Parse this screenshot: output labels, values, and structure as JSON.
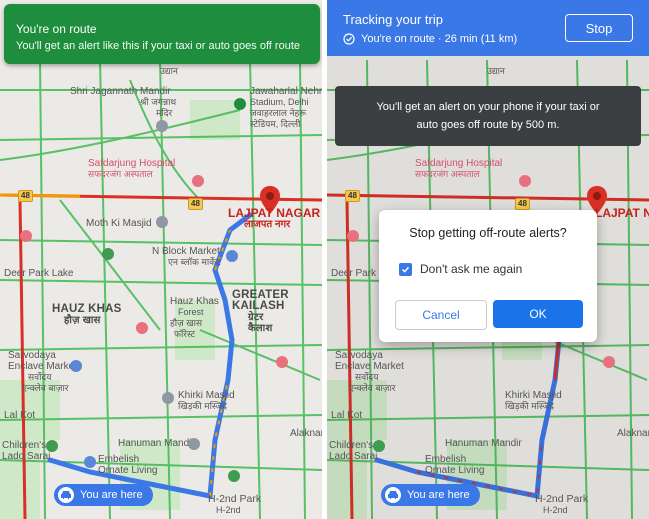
{
  "left": {
    "banner": {
      "title": "You're on route",
      "subtitle": "You'll get an alert like this if your taxi or auto goes off route"
    }
  },
  "right": {
    "header": {
      "title": "Tracking your trip",
      "status": "You're on route · 26 min (11 km)",
      "stop_label": "Stop"
    },
    "toast": {
      "line1": "You'll get an alert on your phone if your taxi or",
      "line2": "auto goes off route by 500 m."
    },
    "dialog": {
      "question": "Stop getting off-route alerts?",
      "checkbox_label": "Don't ask me again",
      "checkbox_checked": true,
      "cancel_label": "Cancel",
      "ok_label": "OK"
    }
  },
  "map": {
    "labels": {
      "shri_jagannath": "Shri Jagannath Mandir",
      "shri_jagannath_hi": "श्री जगन्नाथ",
      "shri_jagannath_hi2": "मंदिर",
      "jawaharlal": "Jawaharlal Nehru",
      "stadium": "Stadium, Delhi",
      "stadium_hi": "जवाहरलाल नेहरू",
      "stadium_hi2": "स्टेडियम, दिल्ली",
      "safdarjung": "Safdarjung Hospital",
      "safdarjung_hi": "सफदरजंग अस्पताल",
      "moth_ki_masjid": "Moth Ki Masjid",
      "lajpat_nagar": "LAJPAT NAGAR",
      "lajpat_nagar_hi": "लाजपत नगर",
      "n_block_market": "N Block Market",
      "n_block_market_hi": "एन ब्लॉक मार्केट",
      "deer_park": "Deer Park Lake",
      "hauz_khas": "HAUZ KHAS",
      "hauz_khas_hi": "हौज़ खास",
      "hauz_khas_forest": "Hauz Khas",
      "hauz_khas_forest2": "Forest",
      "hauz_khas_forest_hi": "हौज़ खास",
      "hauz_khas_forest_hi2": "फॉरेस्ट",
      "greater_kailash": "GREATER",
      "greater_kailash2": "KAILASH",
      "greater_kailash_hi": "ग्रेटर",
      "greater_kailash_hi2": "कैलाश",
      "sarvodaya": "Sarvodaya",
      "enclave_market": "Enclave Market",
      "enclave_market_hi": "सर्वोदय",
      "enclave_market_hi2": "एन्क्लेव बाज़ार",
      "khirki_masjid": "Khirki Masjid",
      "khirki_masjid_hi": "खिड़की मस्जिद",
      "lal_kot": "Lal Kot",
      "hanuman_mandir": "Hanuman Mandir",
      "childrens": "Children's",
      "lado_sarai": "Lado Sarai",
      "embelish": "Embelish",
      "ornate_living": "Ornate Living",
      "h2nd_park": "H-2nd Park",
      "h2nd": "H-2nd",
      "alaknanda": "Alaknanda",
      "uttam": "उद्यान",
      "road_48": "48"
    },
    "you_are_here": "You are here",
    "colors": {
      "traffic_green": "#3fb950",
      "traffic_orange": "#f29900",
      "traffic_red": "#d93025",
      "route_blue": "#3b78e7",
      "map_bg": "#eceae6",
      "park": "#c8e6c9"
    }
  }
}
